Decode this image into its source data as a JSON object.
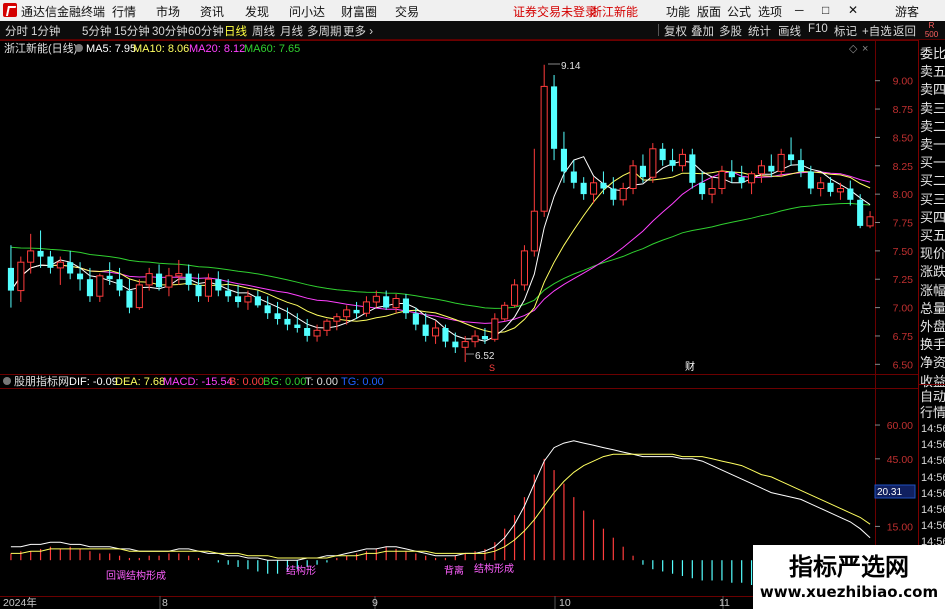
{
  "menubar": {
    "app_title": "通达信金融终端",
    "menus": [
      "行情",
      "市场",
      "资讯",
      "发现",
      "问小达",
      "财富圈",
      "交易"
    ],
    "notice": "证券交易未登录",
    "stock_name": "浙江新能",
    "right_menus": [
      "功能",
      "版面",
      "公式",
      "选项"
    ],
    "user": "游客",
    "window_controls": [
      "─",
      "□",
      "✕"
    ]
  },
  "toolbar": {
    "periods": [
      "分时",
      "1分钟",
      "5分钟",
      "15分钟",
      "30分钟",
      "60分钟",
      "日线",
      "周线",
      "月线",
      "多周期",
      "更多 ›"
    ],
    "active_period": "日线",
    "right_buttons": [
      "复权",
      "叠加",
      "多股",
      "统计",
      "画线",
      "F10",
      "标记",
      "+自选",
      "返回"
    ],
    "r_badge_top": "R",
    "r_badge_bottom": "500"
  },
  "main_legend": {
    "stock": "浙江新能(日线)",
    "ma5": "MA5: 7.95",
    "ma10": "MA10: 8.06",
    "ma20": "MA20: 8.12",
    "ma60": "MA60: 7.65"
  },
  "price_axis": [
    "9.00",
    "8.75",
    "8.50",
    "8.25",
    "8.00",
    "7.75",
    "7.50",
    "7.25",
    "7.00",
    "6.75",
    "6.50"
  ],
  "price_markers": {
    "high": "9.14",
    "low": "6.52",
    "event_s": "S",
    "event_cai": "财"
  },
  "macd_legend": {
    "name": "股朋指标网",
    "dif": "DIF: -0.09",
    "dea": "DEA: 7.68",
    "macd": "MACD: -15.54",
    "b": "B: 0.00",
    "bg": "BG: 0.00",
    "t": "T: 0.00",
    "tg": "TG: 0.00"
  },
  "macd_axis": [
    "60.00",
    "45.00",
    "30.00",
    "15.00"
  ],
  "macd_current": "20.31",
  "macd_signals": [
    "回调结构形成",
    "结构形",
    "背离",
    "结构形成"
  ],
  "date_axis": [
    "2024年",
    "8",
    "9",
    "10",
    "11"
  ],
  "side_panel": {
    "quote_labels": [
      "委比",
      "卖五",
      "卖四",
      "卖三",
      "卖二",
      "卖一",
      "买一",
      "买二",
      "买三",
      "买四",
      "买五",
      "现价",
      "涨跌",
      "涨幅",
      "总量",
      "外盘",
      "换手",
      "净资",
      "收益"
    ],
    "tabs": [
      "自动",
      "行情"
    ],
    "ticks": [
      "14:56",
      "14:56",
      "14:56",
      "14:56",
      "14:56",
      "14:56",
      "14:56",
      "14:56",
      "14:56",
      "14:56",
      "14:56"
    ]
  },
  "watermark": {
    "title": "指标严选网",
    "url": "www.xuezhibiao.com"
  },
  "colors": {
    "up": "#ff3c3c",
    "down": "#54ffff",
    "ma5": "#ffffff",
    "ma10": "#ffff60",
    "ma20": "#ff40ff",
    "ma60": "#30d030",
    "grid": "#6b0000"
  },
  "chart_data": {
    "type": "candlestick",
    "price_range": [
      6.45,
      9.2
    ],
    "ohlc": [
      [
        7.35,
        7.55,
        7.0,
        7.15
      ],
      [
        7.15,
        7.45,
        7.05,
        7.4
      ],
      [
        7.4,
        7.65,
        7.3,
        7.5
      ],
      [
        7.5,
        7.68,
        7.35,
        7.45
      ],
      [
        7.45,
        7.5,
        7.3,
        7.35
      ],
      [
        7.35,
        7.45,
        7.2,
        7.4
      ],
      [
        7.4,
        7.5,
        7.25,
        7.3
      ],
      [
        7.3,
        7.4,
        7.15,
        7.25
      ],
      [
        7.25,
        7.35,
        7.05,
        7.1
      ],
      [
        7.1,
        7.3,
        7.05,
        7.28
      ],
      [
        7.28,
        7.4,
        7.2,
        7.25
      ],
      [
        7.25,
        7.35,
        7.1,
        7.15
      ],
      [
        7.15,
        7.25,
        6.95,
        7.0
      ],
      [
        7.0,
        7.25,
        6.98,
        7.2
      ],
      [
        7.2,
        7.35,
        7.15,
        7.3
      ],
      [
        7.3,
        7.38,
        7.15,
        7.18
      ],
      [
        7.18,
        7.35,
        7.1,
        7.28
      ],
      [
        7.28,
        7.42,
        7.2,
        7.3
      ],
      [
        7.3,
        7.38,
        7.15,
        7.2
      ],
      [
        7.2,
        7.3,
        7.05,
        7.1
      ],
      [
        7.1,
        7.3,
        7.05,
        7.25
      ],
      [
        7.25,
        7.32,
        7.1,
        7.15
      ],
      [
        7.15,
        7.25,
        7.05,
        7.1
      ],
      [
        7.1,
        7.2,
        7.0,
        7.05
      ],
      [
        7.05,
        7.15,
        6.98,
        7.1
      ],
      [
        7.1,
        7.15,
        7.0,
        7.02
      ],
      [
        7.02,
        7.1,
        6.9,
        6.95
      ],
      [
        6.95,
        7.05,
        6.85,
        6.9
      ],
      [
        6.9,
        7.0,
        6.8,
        6.85
      ],
      [
        6.85,
        6.95,
        6.78,
        6.82
      ],
      [
        6.82,
        6.9,
        6.7,
        6.75
      ],
      [
        6.75,
        6.85,
        6.7,
        6.8
      ],
      [
        6.8,
        6.9,
        6.75,
        6.88
      ],
      [
        6.88,
        6.95,
        6.8,
        6.92
      ],
      [
        6.92,
        7.02,
        6.85,
        6.98
      ],
      [
        6.98,
        7.05,
        6.9,
        6.95
      ],
      [
        6.95,
        7.1,
        6.92,
        7.05
      ],
      [
        7.05,
        7.15,
        7.0,
        7.1
      ],
      [
        7.1,
        7.15,
        6.98,
        7.0
      ],
      [
        7.0,
        7.12,
        6.95,
        7.08
      ],
      [
        7.08,
        7.12,
        6.9,
        6.95
      ],
      [
        6.95,
        7.0,
        6.8,
        6.85
      ],
      [
        6.85,
        6.95,
        6.7,
        6.75
      ],
      [
        6.75,
        6.88,
        6.68,
        6.82
      ],
      [
        6.82,
        6.85,
        6.65,
        6.7
      ],
      [
        6.7,
        6.78,
        6.6,
        6.65
      ],
      [
        6.65,
        6.75,
        6.52,
        6.7
      ],
      [
        6.7,
        6.8,
        6.65,
        6.75
      ],
      [
        6.75,
        6.82,
        6.68,
        6.72
      ],
      [
        6.72,
        6.95,
        6.7,
        6.9
      ],
      [
        6.9,
        7.05,
        6.88,
        7.02
      ],
      [
        7.02,
        7.25,
        7.0,
        7.2
      ],
      [
        7.2,
        7.55,
        7.15,
        7.5
      ],
      [
        7.5,
        8.4,
        7.45,
        7.85
      ],
      [
        7.85,
        9.14,
        7.8,
        8.95
      ],
      [
        8.95,
        9.05,
        8.3,
        8.4
      ],
      [
        8.4,
        8.55,
        8.1,
        8.2
      ],
      [
        8.2,
        8.3,
        8.05,
        8.1
      ],
      [
        8.1,
        8.15,
        7.95,
        8.0
      ],
      [
        8.0,
        8.15,
        7.92,
        8.1
      ],
      [
        8.1,
        8.2,
        8.0,
        8.05
      ],
      [
        8.05,
        8.15,
        7.9,
        7.95
      ],
      [
        7.95,
        8.1,
        7.9,
        8.05
      ],
      [
        8.05,
        8.3,
        8.0,
        8.25
      ],
      [
        8.25,
        8.35,
        8.1,
        8.15
      ],
      [
        8.15,
        8.45,
        8.1,
        8.4
      ],
      [
        8.4,
        8.45,
        8.25,
        8.3
      ],
      [
        8.3,
        8.4,
        8.2,
        8.25
      ],
      [
        8.25,
        8.4,
        8.2,
        8.35
      ],
      [
        8.35,
        8.4,
        8.05,
        8.1
      ],
      [
        8.1,
        8.2,
        7.95,
        8.0
      ],
      [
        8.0,
        8.15,
        7.92,
        8.05
      ],
      [
        8.05,
        8.25,
        8.0,
        8.2
      ],
      [
        8.2,
        8.3,
        8.1,
        8.15
      ],
      [
        8.15,
        8.25,
        8.05,
        8.1
      ],
      [
        8.1,
        8.2,
        8.0,
        8.18
      ],
      [
        8.18,
        8.3,
        8.1,
        8.25
      ],
      [
        8.25,
        8.35,
        8.15,
        8.2
      ],
      [
        8.2,
        8.4,
        8.15,
        8.35
      ],
      [
        8.35,
        8.5,
        8.25,
        8.3
      ],
      [
        8.3,
        8.4,
        8.15,
        8.2
      ],
      [
        8.2,
        8.25,
        8.0,
        8.05
      ],
      [
        8.05,
        8.15,
        7.98,
        8.1
      ],
      [
        8.1,
        8.15,
        7.98,
        8.02
      ],
      [
        8.02,
        8.1,
        7.95,
        8.05
      ],
      [
        8.05,
        8.12,
        7.9,
        7.95
      ],
      [
        7.95,
        8.0,
        7.7,
        7.72
      ],
      [
        7.72,
        7.85,
        7.7,
        7.8
      ]
    ],
    "ma_periods": {
      "ma5": 5,
      "ma10": 10,
      "ma20": 20,
      "ma60": 60
    },
    "macd_range": [
      -15,
      72
    ],
    "macd_hist": [
      3,
      4,
      4,
      5,
      6,
      5,
      6,
      5,
      4,
      3,
      3,
      2,
      1,
      1,
      2,
      2,
      3,
      3,
      2,
      1,
      0,
      -1,
      -2,
      -3,
      -4,
      -5,
      -6,
      -6,
      -5,
      -4,
      -3,
      -2,
      -1,
      1,
      2,
      3,
      4,
      5,
      6,
      5,
      4,
      3,
      2,
      1,
      1,
      2,
      3,
      4,
      5,
      8,
      14,
      20,
      28,
      38,
      45,
      40,
      34,
      28,
      22,
      18,
      14,
      10,
      6,
      2,
      -2,
      -4,
      -5,
      -6,
      -7,
      -8,
      -9,
      -9,
      -9,
      -10,
      -10,
      -11,
      -11,
      -12,
      -12,
      -13,
      -13,
      -14,
      -14,
      -15,
      -15,
      -15,
      -14,
      -12
    ],
    "diff_line": [
      6,
      6,
      7,
      7,
      8,
      8,
      7,
      7,
      6,
      6,
      6,
      5,
      5,
      4,
      4,
      4,
      4,
      5,
      5,
      4,
      3,
      3,
      2,
      2,
      1,
      1,
      0,
      0,
      0,
      0,
      1,
      1,
      2,
      2,
      3,
      4,
      5,
      5,
      6,
      6,
      5,
      4,
      3,
      2,
      2,
      2,
      3,
      3,
      4,
      6,
      10,
      16,
      24,
      34,
      44,
      50,
      52,
      53,
      52,
      51,
      50,
      49,
      48,
      47,
      46,
      46,
      46,
      46,
      45,
      45,
      44,
      42,
      40,
      38,
      36,
      34,
      32,
      30,
      29,
      28,
      27,
      25,
      23,
      21,
      19,
      17,
      14,
      10
    ],
    "dea_line": [
      3,
      3,
      4,
      4,
      5,
      5,
      5,
      5,
      5,
      5,
      5,
      5,
      4,
      4,
      4,
      4,
      4,
      4,
      4,
      4,
      4,
      3,
      3,
      3,
      2,
      2,
      2,
      1,
      1,
      1,
      1,
      1,
      1,
      2,
      2,
      2,
      3,
      3,
      4,
      4,
      4,
      4,
      4,
      3,
      3,
      3,
      3,
      3,
      3,
      4,
      6,
      9,
      13,
      18,
      24,
      30,
      35,
      39,
      42,
      44,
      46,
      47,
      47,
      47,
      47,
      47,
      47,
      47,
      46,
      46,
      46,
      45,
      44,
      43,
      42,
      40,
      38,
      37,
      35,
      33,
      31,
      29,
      27,
      25,
      23,
      21,
      19,
      16
    ]
  }
}
